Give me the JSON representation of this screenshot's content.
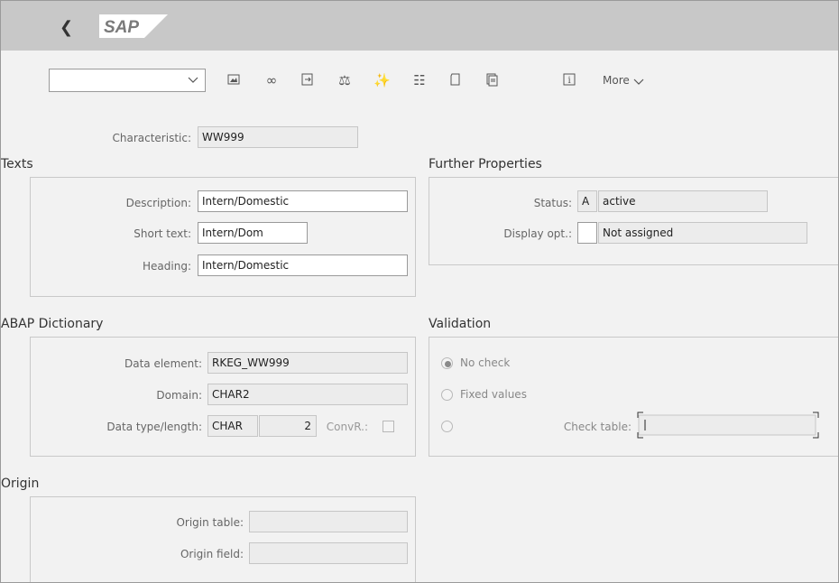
{
  "shell": {
    "logo": "SAP"
  },
  "toolbar": {
    "more_label": "More"
  },
  "characteristic": {
    "label": "Characteristic:",
    "value": "WW999"
  },
  "texts": {
    "title": "Texts",
    "description_label": "Description:",
    "description_value": "Intern/Domestic",
    "short_text_label": "Short text:",
    "short_text_value": "Intern/Dom",
    "heading_label": "Heading:",
    "heading_value": "Intern/Domestic"
  },
  "further": {
    "title": "Further Properties",
    "status_label": "Status:",
    "status_code": "A",
    "status_text": "active",
    "display_label": "Display opt.:",
    "display_code": "",
    "display_text": "Not assigned"
  },
  "abap": {
    "title": "ABAP Dictionary",
    "data_element_label": "Data element:",
    "data_element_value": "RKEG_WW999",
    "domain_label": "Domain:",
    "domain_value": "CHAR2",
    "datatype_label": "Data type/length:",
    "datatype_value": "CHAR",
    "length_value": "2",
    "convr_label": "ConvR.:"
  },
  "validation": {
    "title": "Validation",
    "no_check": "No check",
    "fixed_values": "Fixed values",
    "check_table_label": "Check table:",
    "selected": "No check"
  },
  "origin": {
    "title": "Origin",
    "table_label": "Origin table:",
    "table_value": "",
    "field_label": "Origin field:",
    "field_value": ""
  }
}
